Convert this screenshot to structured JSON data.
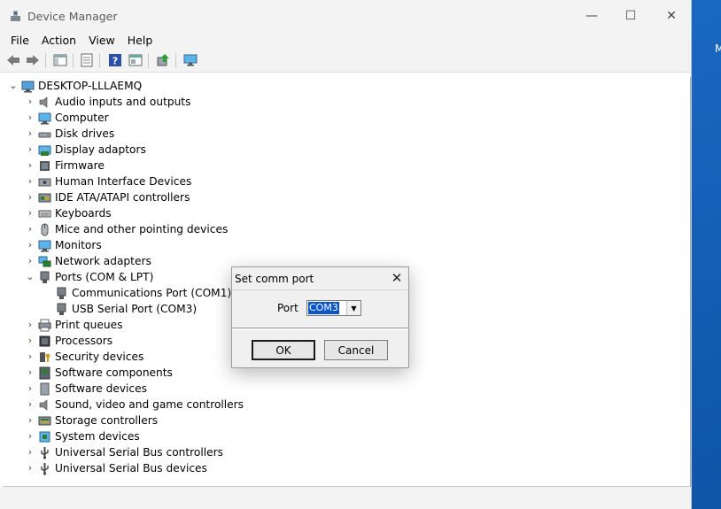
{
  "window": {
    "title": "Device Manager",
    "caption": {
      "minimize": "—",
      "maximize": "☐",
      "close": "✕"
    }
  },
  "menu": [
    "File",
    "Action",
    "View",
    "Help"
  ],
  "desktop_letter": "M",
  "tree": {
    "root": "DESKTOP-LLLAEMQ",
    "categories": [
      {
        "label": "Audio inputs and outputs",
        "icon": "speaker-icon"
      },
      {
        "label": "Computer",
        "icon": "monitor-icon"
      },
      {
        "label": "Disk drives",
        "icon": "disk-drive-icon"
      },
      {
        "label": "Display adaptors",
        "icon": "display-adapter-icon"
      },
      {
        "label": "Firmware",
        "icon": "firmware-icon"
      },
      {
        "label": "Human Interface Devices",
        "icon": "hid-icon"
      },
      {
        "label": "IDE ATA/ATAPI controllers",
        "icon": "ide-controller-icon"
      },
      {
        "label": "Keyboards",
        "icon": "keyboard-icon"
      },
      {
        "label": "Mice and other pointing devices",
        "icon": "mouse-icon"
      },
      {
        "label": "Monitors",
        "icon": "monitor-icon"
      },
      {
        "label": "Network adapters",
        "icon": "network-adapter-icon"
      },
      {
        "label": "Ports (COM & LPT)",
        "icon": "port-icon",
        "expanded": true,
        "children": [
          "Communications Port (COM1)",
          "USB Serial Port (COM3)"
        ]
      },
      {
        "label": "Print queues",
        "icon": "printer-icon"
      },
      {
        "label": "Processors",
        "icon": "processor-icon"
      },
      {
        "label": "Security devices",
        "icon": "security-key-icon"
      },
      {
        "label": "Software components",
        "icon": "software-component-icon"
      },
      {
        "label": "Software devices",
        "icon": "software-device-icon"
      },
      {
        "label": "Sound, video and game controllers",
        "icon": "speaker-icon"
      },
      {
        "label": "Storage controllers",
        "icon": "storage-controller-icon"
      },
      {
        "label": "System devices",
        "icon": "system-device-icon"
      },
      {
        "label": "Universal Serial Bus controllers",
        "icon": "usb-icon"
      },
      {
        "label": "Universal Serial Bus devices",
        "icon": "usb-icon"
      }
    ]
  },
  "dialog": {
    "title": "Set comm port",
    "port_label": "Port",
    "port_value": "COM3",
    "ok": "OK",
    "cancel": "Cancel",
    "close": "✕"
  },
  "colors": {
    "accent": "#0a56c9",
    "desktop": "#1c6bc4"
  }
}
